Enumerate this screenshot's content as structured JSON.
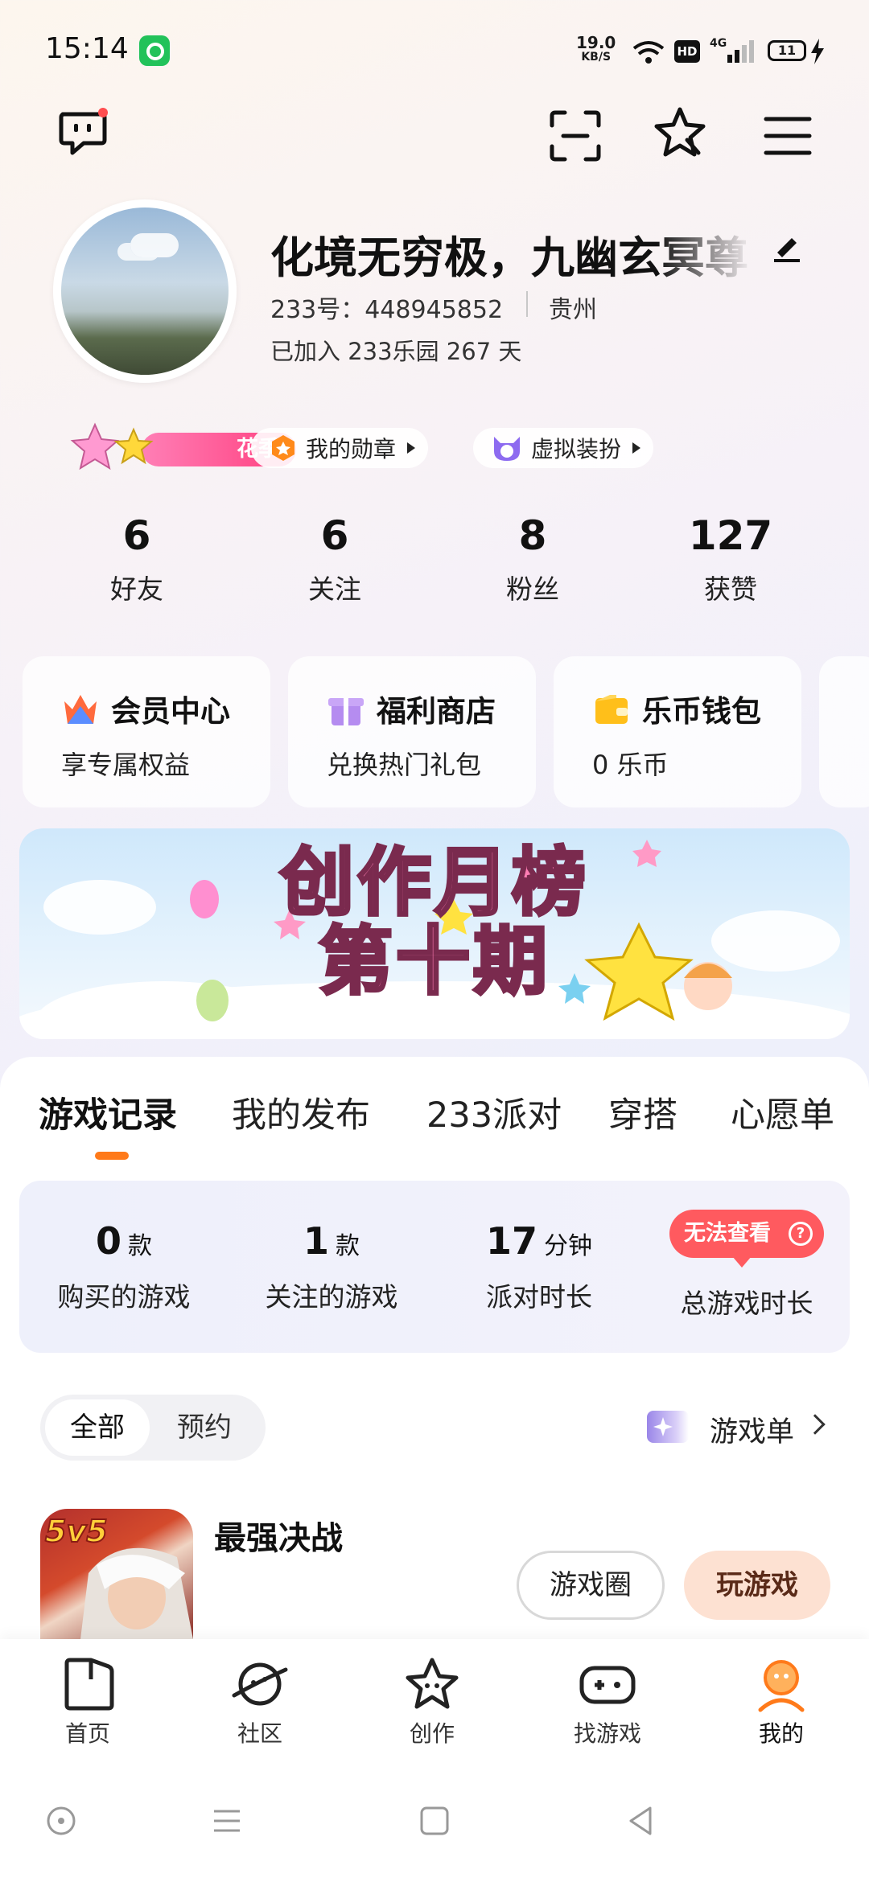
{
  "status": {
    "time": "15:14",
    "net_speed": "19.0",
    "net_unit": "KB/S",
    "hd": "HD",
    "signal": "4G",
    "battery": "11"
  },
  "header": {
    "icons": [
      "chat-bubble-icon",
      "scan-icon",
      "star-sparkle-icon",
      "menu-icon"
    ]
  },
  "profile": {
    "name": "化境无穷极，九幽玄冥尊",
    "id_text": "233号：448945852",
    "location": "贵州",
    "joined": "已加入 233乐园 267 天"
  },
  "chips": {
    "season": "花季",
    "medals": "我的勋章",
    "dress": "虚拟装扮"
  },
  "stats": [
    {
      "value": "6",
      "label": "好友"
    },
    {
      "value": "6",
      "label": "关注"
    },
    {
      "value": "8",
      "label": "粉丝"
    },
    {
      "value": "127",
      "label": "获赞"
    }
  ],
  "cards": [
    {
      "title": "会员中心",
      "sub": "享专属权益",
      "icon": "crown-icon"
    },
    {
      "title": "福利商店",
      "sub": "兑换热门礼包",
      "icon": "gift-icon"
    },
    {
      "title": "乐币钱包",
      "sub": "0 乐币",
      "icon": "wallet-icon"
    }
  ],
  "banner": {
    "line1": "创作月榜",
    "line2": "第十期"
  },
  "tabs": [
    "游戏记录",
    "我的发布",
    "233派对",
    "穿搭",
    "心愿单"
  ],
  "game_stats": [
    {
      "value": "0",
      "unit": "款",
      "label": "购买的游戏"
    },
    {
      "value": "1",
      "unit": "款",
      "label": "关注的游戏"
    },
    {
      "value": "17",
      "unit": "分钟",
      "label": "派对时长"
    },
    {
      "label": "总游戏时长",
      "badge": "无法查看",
      "badge_icon": "?"
    }
  ],
  "filter": {
    "all": "全部",
    "reserve": "预约",
    "game_list": "游戏单"
  },
  "game": {
    "name": "最强决战",
    "icon_tag": "5v5",
    "btn_circle": "游戏圈",
    "btn_play": "玩游戏"
  },
  "nav": [
    {
      "label": "首页",
      "icon": "home-icon"
    },
    {
      "label": "社区",
      "icon": "planet-icon"
    },
    {
      "label": "创作",
      "icon": "create-star-icon"
    },
    {
      "label": "找游戏",
      "icon": "gamepad-icon"
    },
    {
      "label": "我的",
      "icon": "profile-icon"
    }
  ],
  "colors": {
    "accent": "#ff7a1a",
    "badge": "#ff5a5f",
    "play_btn": "#fde1d2",
    "season_pill": "#ff3e7e"
  }
}
